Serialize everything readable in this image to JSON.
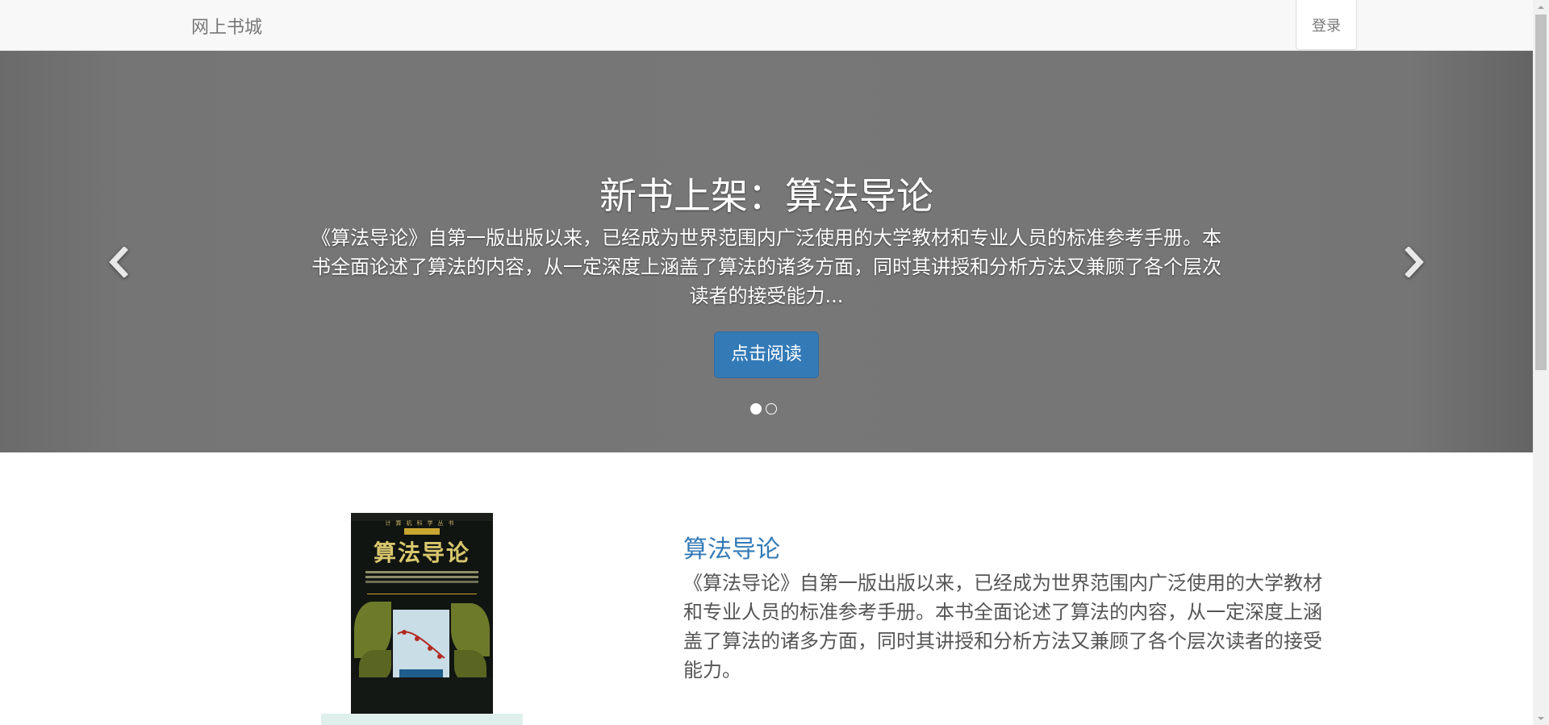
{
  "navbar": {
    "brand": "网上书城",
    "login_label": "登录"
  },
  "carousel": {
    "title": "新书上架：算法导论",
    "description": "《算法导论》自第一版出版以来，已经成为世界范围内广泛使用的大学教材和专业人员的标准参考手册。本书全面论述了算法的内容，从一定深度上涵盖了算法的诸多方面，同时其讲授和分析方法又兼顾了各个层次读者的接受能力...",
    "button_label": "点击阅读",
    "active_slide": 1,
    "slide_count": 2,
    "icons": {
      "prev": "chevron-left-icon",
      "next": "chevron-right-icon"
    }
  },
  "book": {
    "cover_title": "算法导论",
    "cover_series": "计算机科学丛书",
    "cover_subtitle": "Introduction to Algorithms",
    "title": "算法导论",
    "description": "《算法导论》自第一版出版以来，已经成为世界范围内广泛使用的大学教材和专业人员的标准参考手册。本书全面论述了算法的内容，从一定深度上涵盖了算法的诸多方面，同时其讲授和分析方法又兼顾了各个层次读者的接受能力。"
  },
  "colors": {
    "navbar_bg": "#f8f8f8",
    "carousel_bg": "#777777",
    "primary_button": "#337ab7",
    "link": "#337ab7",
    "body_text": "#555555"
  }
}
